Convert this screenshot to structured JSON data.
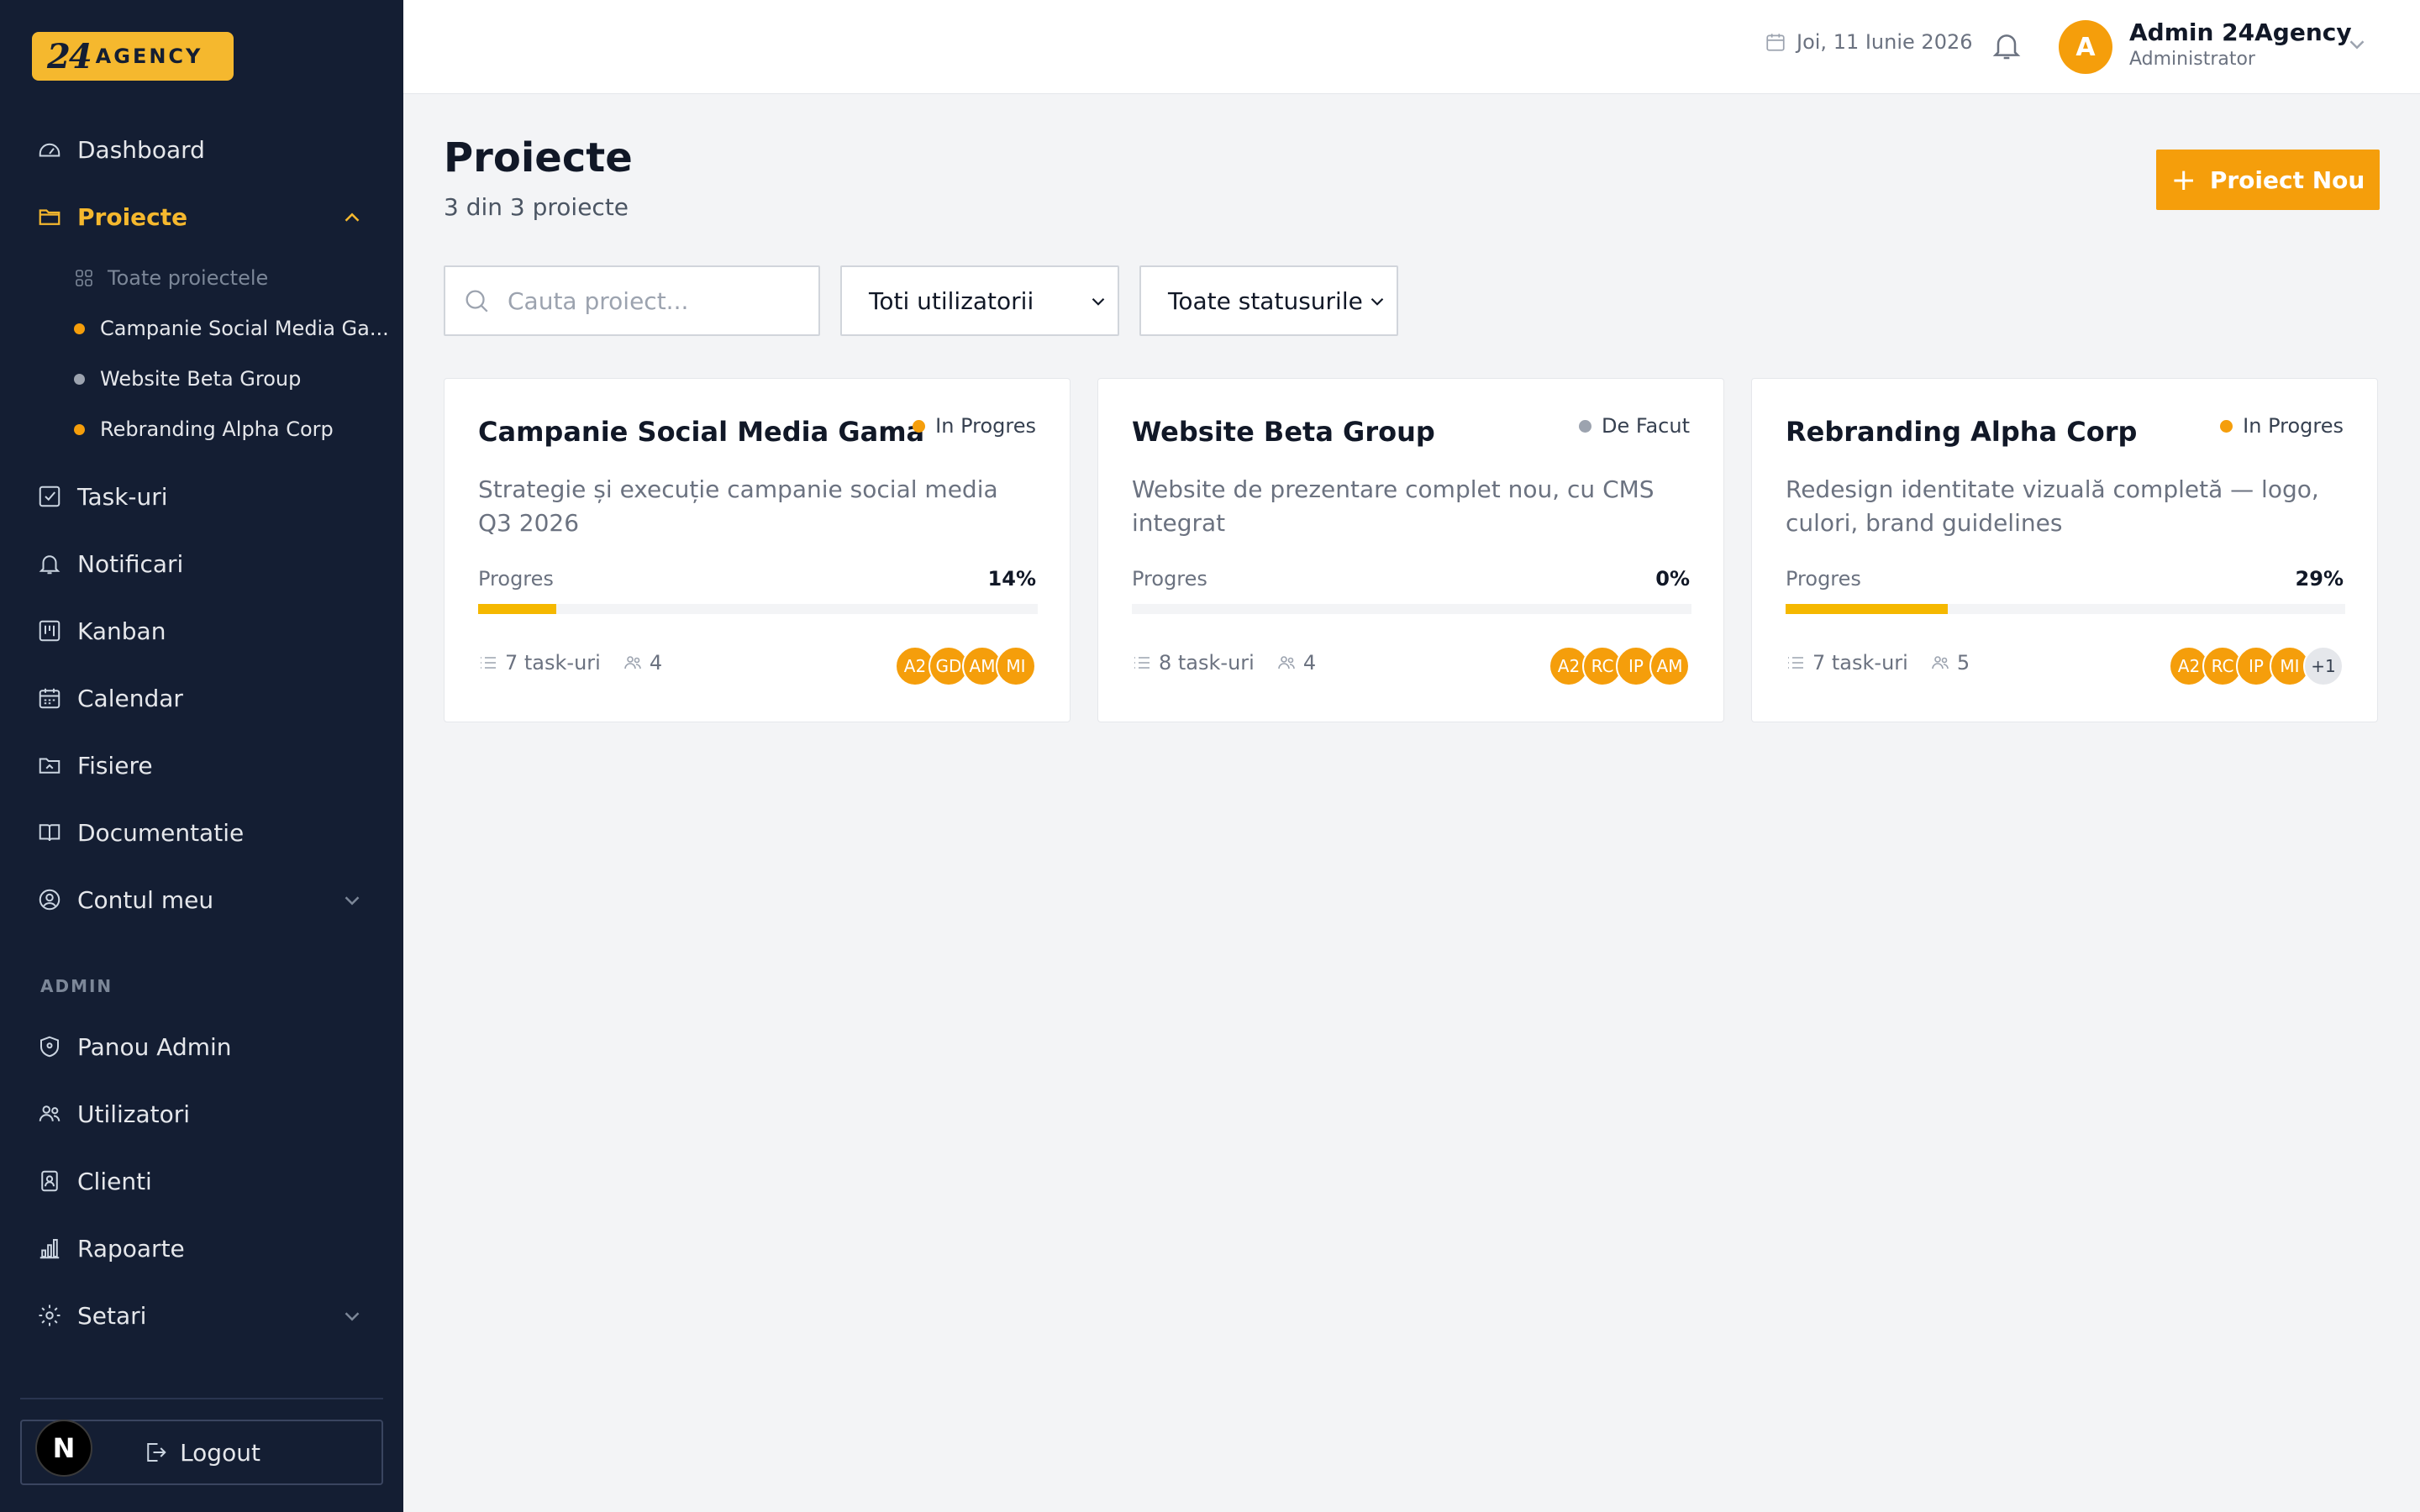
{
  "brand": {
    "mark": "24",
    "text": "AGENCY"
  },
  "sidebar": {
    "nav": [
      {
        "label": "Dashboard",
        "icon": "gauge-icon"
      },
      {
        "label": "Proiecte",
        "icon": "folder-icon",
        "active": true
      },
      {
        "label": "Task-uri",
        "icon": "checkbox-icon"
      },
      {
        "label": "Notificari",
        "icon": "bell-icon"
      },
      {
        "label": "Kanban",
        "icon": "kanban-icon"
      },
      {
        "label": "Calendar",
        "icon": "calendar-icon"
      },
      {
        "label": "Fisiere",
        "icon": "file-icon"
      },
      {
        "label": "Documentatie",
        "icon": "book-icon"
      },
      {
        "label": "Contul meu",
        "icon": "user-circle-icon"
      }
    ],
    "projects_sub": [
      {
        "label": "Toate proiectele",
        "icon": "grid-icon"
      },
      {
        "label": "Campanie Social Media Ga...",
        "dot": "#f59e0b"
      },
      {
        "label": "Website Beta Group",
        "dot": "#9ca3af"
      },
      {
        "label": "Rebranding Alpha Corp",
        "dot": "#f59e0b"
      }
    ],
    "admin_label": "ADMIN",
    "admin_nav": [
      {
        "label": "Panou Admin",
        "icon": "shield-icon"
      },
      {
        "label": "Utilizatori",
        "icon": "users-icon"
      },
      {
        "label": "Clienti",
        "icon": "contact-icon"
      },
      {
        "label": "Rapoarte",
        "icon": "bar-chart-icon"
      },
      {
        "label": "Setari",
        "icon": "gear-icon"
      }
    ],
    "logout": "Logout",
    "n_badge": "N"
  },
  "header": {
    "date": "Joi, 11 Iunie 2026",
    "user_initial": "A",
    "user_name": "Admin 24Agency",
    "user_role": "Administrator"
  },
  "main": {
    "title": "Proiecte",
    "subtitle": "3 din 3 proiecte",
    "new_button": "Proiect Nou",
    "search_placeholder": "Cauta proiect...",
    "filter_users": "Toti utilizatorii",
    "filter_status": "Toate statusurile",
    "progress_label": "Progres",
    "cards": [
      {
        "title": "Campanie Social Media Gama",
        "status": "In Progres",
        "status_color": "#f59e0b",
        "description": "Strategie și execuție campanie social media Q3 2026",
        "progress": 14,
        "progress_text": "14%",
        "tasks": "7 task-uri",
        "members": "4",
        "avatars": [
          "A2",
          "GD",
          "AM",
          "MI"
        ]
      },
      {
        "title": "Website Beta Group",
        "status": "De Facut",
        "status_color": "#9ca3af",
        "description": "Website de prezentare complet nou, cu CMS integrat",
        "progress": 0,
        "progress_text": "0%",
        "tasks": "8 task-uri",
        "members": "4",
        "avatars": [
          "A2",
          "RC",
          "IP",
          "AM"
        ]
      },
      {
        "title": "Rebranding Alpha Corp",
        "status": "In Progres",
        "status_color": "#f59e0b",
        "description": "Redesign identitate vizuală completă — logo, culori, brand guidelines",
        "progress": 29,
        "progress_text": "29%",
        "tasks": "7 task-uri",
        "members": "5",
        "avatars": [
          "A2",
          "RC",
          "IP",
          "MI"
        ],
        "more": "+1"
      }
    ]
  },
  "colors": {
    "accent": "#f59e0b",
    "sidebar_bg": "#141e33",
    "brand": "#f5b82e"
  }
}
